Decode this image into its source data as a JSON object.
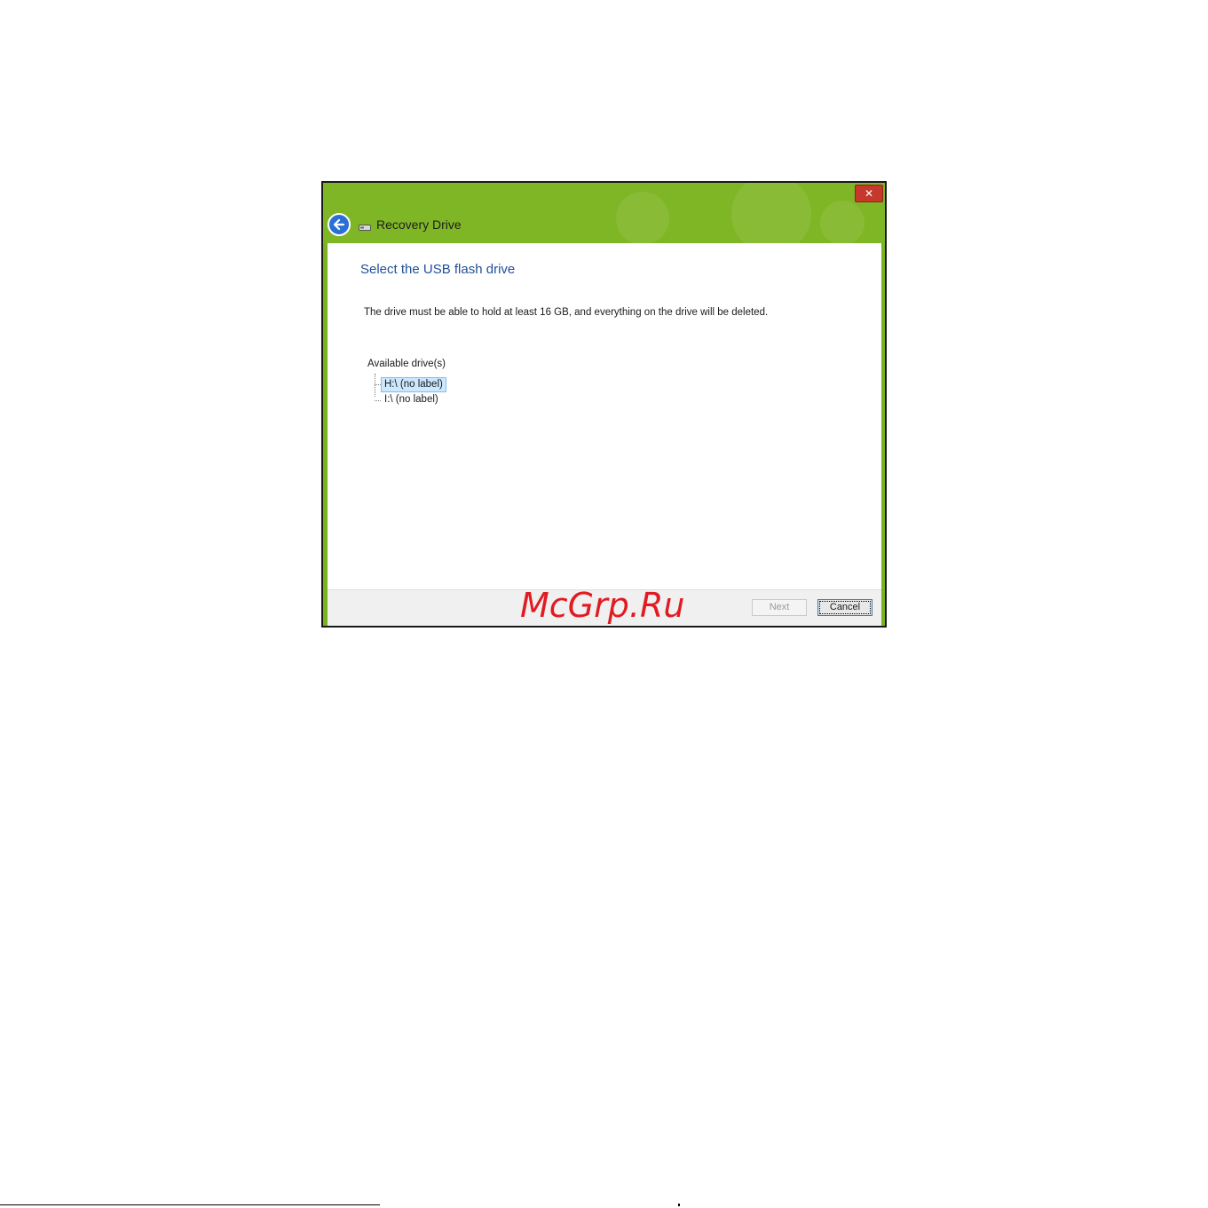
{
  "window": {
    "title": "Recovery Drive",
    "close_label": "✕"
  },
  "content": {
    "heading": "Select the USB flash drive",
    "description": "The drive must be able to hold at least 16 GB, and everything on the drive will be deleted.",
    "tree_label": "Available drive(s)",
    "drives": [
      {
        "label": "H:\\ (no label)",
        "selected": true
      },
      {
        "label": "I:\\ (no label)",
        "selected": false
      }
    ]
  },
  "footer": {
    "next_label": "Next",
    "cancel_label": "Cancel"
  },
  "watermark": "McGrp.Ru",
  "colors": {
    "titlebar": "#7fb626",
    "heading": "#1f4f9a",
    "close": "#c7382c",
    "back_button": "#2a6fd6",
    "watermark": "#e11b22"
  },
  "icons": [
    "close-icon",
    "back-arrow-icon",
    "usb-drive-icon"
  ]
}
